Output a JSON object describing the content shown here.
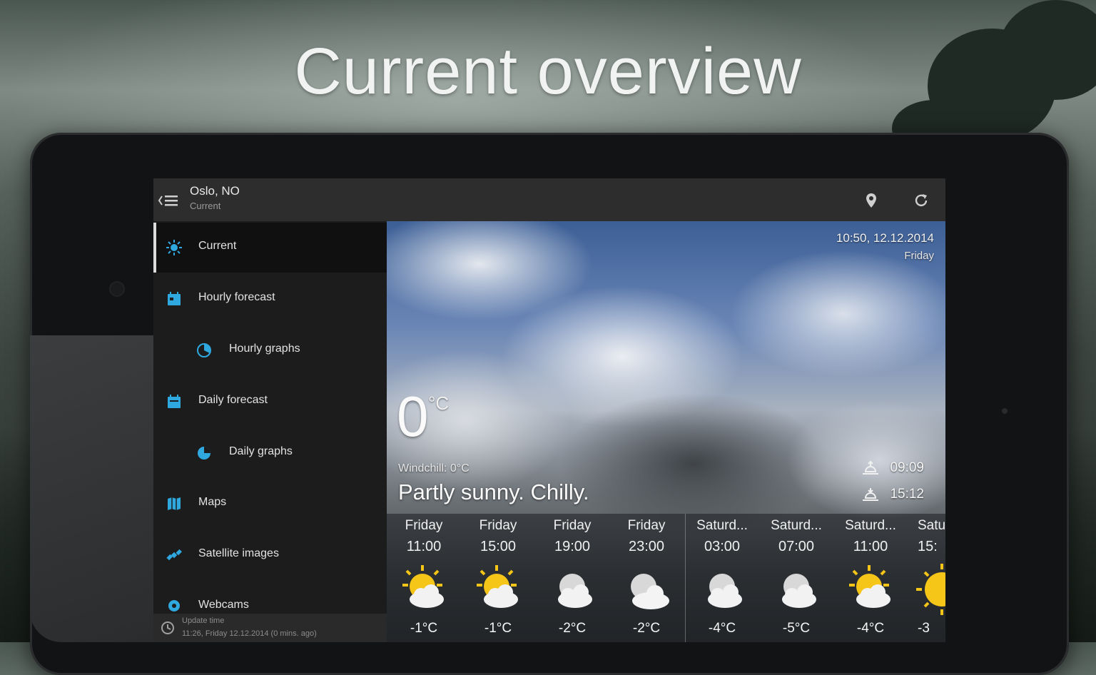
{
  "promo": {
    "headline": "Current overview"
  },
  "actionbar": {
    "location": "Oslo, NO",
    "subtitle": "Current",
    "icons": {
      "menu": "drawer-menu-icon",
      "location": "location-pin-icon",
      "refresh": "refresh-icon"
    }
  },
  "drawer": {
    "items": [
      {
        "label": "Current",
        "icon": "sun-icon",
        "active": true
      },
      {
        "label": "Hourly forecast",
        "icon": "calendar-icon",
        "active": false
      },
      {
        "label": "Hourly graphs",
        "icon": "pie-chart-icon",
        "active": false
      },
      {
        "label": "Daily forecast",
        "icon": "calendar-icon",
        "active": false
      },
      {
        "label": "Daily graphs",
        "icon": "pie-chart-icon",
        "active": false
      },
      {
        "label": "Maps",
        "icon": "map-icon",
        "active": false
      },
      {
        "label": "Satellite images",
        "icon": "satellite-icon",
        "active": false
      },
      {
        "label": "Webcams",
        "icon": "webcam-icon",
        "active": false
      }
    ],
    "update": {
      "label": "Update time",
      "value": "11:26, Friday 12.12.2014 (0 mins. ago)"
    }
  },
  "current": {
    "datetime": "10:50, 12.12.2014",
    "weekday": "Friday",
    "temperature": "0",
    "unit": "°C",
    "windchill": "Windchill: 0°C",
    "condition": "Partly sunny. Chilly.",
    "sunrise": "09:09",
    "sunset": "15:12"
  },
  "forecast": [
    {
      "day": "Friday",
      "time": "11:00",
      "temp": "-1°C",
      "icon": "partly-sunny-icon"
    },
    {
      "day": "Friday",
      "time": "15:00",
      "temp": "-1°C",
      "icon": "partly-sunny-icon"
    },
    {
      "day": "Friday",
      "time": "19:00",
      "temp": "-2°C",
      "icon": "partly-cloudy-night-icon"
    },
    {
      "day": "Friday",
      "time": "23:00",
      "temp": "-2°C",
      "icon": "cloudy-night-icon"
    },
    {
      "day": "Saturd...",
      "time": "03:00",
      "temp": "-4°C",
      "icon": "partly-cloudy-night-icon"
    },
    {
      "day": "Saturd...",
      "time": "07:00",
      "temp": "-5°C",
      "icon": "partly-cloudy-night-icon"
    },
    {
      "day": "Saturd...",
      "time": "11:00",
      "temp": "-4°C",
      "icon": "partly-sunny-icon"
    },
    {
      "day": "Satu",
      "time": "15:",
      "temp": "-3",
      "icon": "sunny-icon"
    }
  ],
  "colors": {
    "accent": "#2fa8e0",
    "sun": "#f5c518",
    "drawer": "#1c1c1c",
    "actionbar": "#2d2d2d"
  }
}
